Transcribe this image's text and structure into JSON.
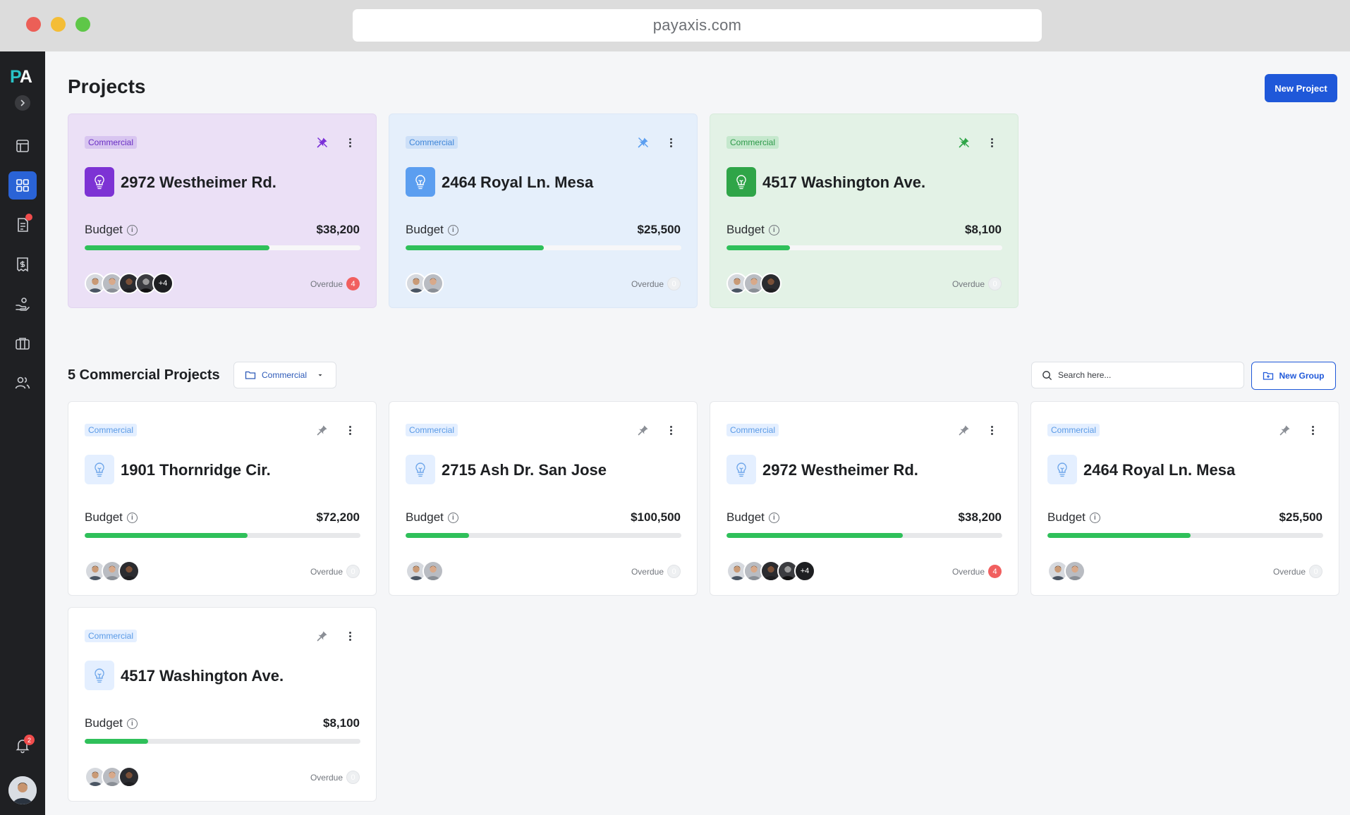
{
  "browser": {
    "url": "payaxis.com"
  },
  "sidebar": {
    "logo_p": "P",
    "logo_a": "A",
    "notification_count": "2"
  },
  "header": {
    "title": "Projects",
    "new_project_label": "New Project"
  },
  "pinned": [
    {
      "tag": "Commercial",
      "title": "2972 Westheimer Rd.",
      "budget_label": "Budget",
      "budget": "$38,200",
      "progress": 0.67,
      "more": "+4",
      "overdue_label": "Overdue",
      "overdue": "4",
      "theme": "purple"
    },
    {
      "tag": "Commercial",
      "title": "2464 Royal Ln. Mesa",
      "budget_label": "Budget",
      "budget": "$25,500",
      "progress": 0.5,
      "more": "",
      "overdue_label": "Overdue",
      "overdue": "0",
      "theme": "blue"
    },
    {
      "tag": "Commercial",
      "title": "4517 Washington Ave.",
      "budget_label": "Budget",
      "budget": "$8,100",
      "progress": 0.23,
      "more": "",
      "overdue_label": "Overdue",
      "overdue": "0",
      "theme": "green"
    }
  ],
  "group": {
    "title": "5 Commercial Projects",
    "filter_label": "Commercial",
    "search_placeholder": "Search here...",
    "new_group_label": "New Group"
  },
  "projects": [
    {
      "tag": "Commercial",
      "title": "1901 Thornridge Cir.",
      "budget_label": "Budget",
      "budget": "$72,200",
      "progress": 0.59,
      "more": "",
      "overdue_label": "Overdue",
      "overdue": "0"
    },
    {
      "tag": "Commercial",
      "title": "2715 Ash Dr. San Jose",
      "budget_label": "Budget",
      "budget": "$100,500",
      "progress": 0.23,
      "more": "",
      "overdue_label": "Overdue",
      "overdue": "0"
    },
    {
      "tag": "Commercial",
      "title": "2972 Westheimer Rd.",
      "budget_label": "Budget",
      "budget": "$38,200",
      "progress": 0.64,
      "more": "+4",
      "overdue_label": "Overdue",
      "overdue": "4"
    },
    {
      "tag": "Commercial",
      "title": "2464 Royal Ln. Mesa",
      "budget_label": "Budget",
      "budget": "$25,500",
      "progress": 0.52,
      "more": "",
      "overdue_label": "Overdue",
      "overdue": "0"
    },
    {
      "tag": "Commercial",
      "title": "4517 Washington Ave.",
      "budget_label": "Budget",
      "budget": "$8,100",
      "progress": 0.23,
      "more": "",
      "overdue_label": "Overdue",
      "overdue": "0"
    }
  ],
  "colors": {
    "accent": "#1f58d9",
    "progress": "#2fc05a",
    "alert": "#f15f5f",
    "sidebar": "#1f2023"
  }
}
